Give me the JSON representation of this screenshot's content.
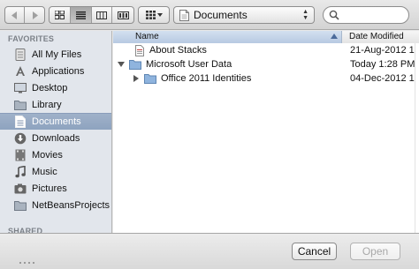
{
  "toolbar": {
    "path_label": "Documents",
    "search_placeholder": ""
  },
  "sidebar": {
    "favorites_heading": "FAVORITES",
    "shared_heading": "SHARED",
    "items": [
      {
        "label": "All My Files",
        "icon": "all-my-files-icon"
      },
      {
        "label": "Applications",
        "icon": "applications-icon"
      },
      {
        "label": "Desktop",
        "icon": "desktop-icon"
      },
      {
        "label": "Library",
        "icon": "folder-icon"
      },
      {
        "label": "Documents",
        "icon": "documents-icon",
        "selected": true
      },
      {
        "label": "Downloads",
        "icon": "downloads-icon"
      },
      {
        "label": "Movies",
        "icon": "movies-icon"
      },
      {
        "label": "Music",
        "icon": "music-icon"
      },
      {
        "label": "Pictures",
        "icon": "pictures-icon"
      },
      {
        "label": "NetBeansProjects",
        "icon": "folder-icon"
      }
    ]
  },
  "list": {
    "columns": {
      "name": "Name",
      "date": "Date Modified"
    },
    "rows": [
      {
        "name": "About Stacks",
        "date": "21-Aug-2012 1",
        "type": "pdf-file-icon",
        "indent": 0,
        "disclosure": "none"
      },
      {
        "name": "Microsoft User Data",
        "date": "Today 1:28 PM",
        "type": "folder-icon",
        "indent": 0,
        "disclosure": "expanded"
      },
      {
        "name": "Office 2011 Identities",
        "date": "04-Dec-2012 1",
        "type": "folder-icon",
        "indent": 1,
        "disclosure": "collapsed"
      }
    ]
  },
  "buttons": {
    "cancel": "Cancel",
    "open": "Open"
  },
  "colors": {
    "selection": "#97abc6",
    "folder": "#8fb4de"
  }
}
